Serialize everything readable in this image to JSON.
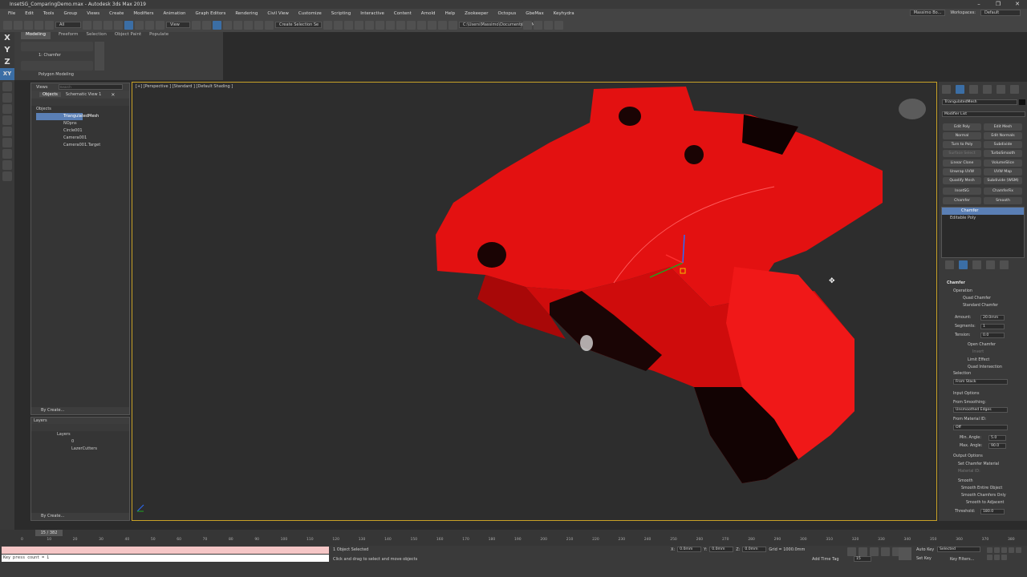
{
  "window": {
    "title": "InsetSG_ComparingDemo.max - Autodesk 3ds Max 2019"
  },
  "menu": [
    "File",
    "Edit",
    "Tools",
    "Group",
    "Views",
    "Create",
    "Modifiers",
    "Animation",
    "Graph Editors",
    "Rendering",
    "Civil View",
    "Customize",
    "Scripting",
    "Interactive",
    "Content",
    "Arnold",
    "Help",
    "Zookeeper",
    "Octopus",
    "GbeMax",
    "Keyhydra"
  ],
  "menu_right": {
    "user": "Massimo Bo...",
    "workspaces_label": "Workspaces:",
    "workspace": "Default"
  },
  "toolbar": {
    "selection_filter": "All",
    "view_dd": "View",
    "named_sel": "Create Selection Se",
    "path": "C:\\Users\\Massimo\\Documents\\3dsMax"
  },
  "ribbon": {
    "tabs": [
      "Modeling",
      "Freeform",
      "Selection",
      "Object Paint",
      "Populate"
    ],
    "level": "1: Chamfer",
    "panel": "Polygon Modeling"
  },
  "axes": [
    "X",
    "Y",
    "Z",
    "XY"
  ],
  "scene_explorer": {
    "header_views": "Views",
    "search_placeholder": "Search",
    "tab_objects": "Objects",
    "tab_schematic": "Schematic View 1",
    "root": "Objects",
    "items": [
      "TriangulatedMesh",
      "NOpns",
      "Circle001",
      "Camera001",
      "Camera001.Target"
    ],
    "footer": "By Create..."
  },
  "layers": {
    "title": "Layers",
    "root": "Layers",
    "items": [
      "0",
      "LazerCutters"
    ],
    "footer": "By Create..."
  },
  "viewport": {
    "label": "[+] [Perspective ] [Standard ] [Default Shading ]",
    "model_color": "#e31111"
  },
  "command_panel": {
    "object_name": "TriangulatedMesh",
    "modifier_list": "Modifier List",
    "modifier_buttons": [
      [
        "Edit Poly",
        "Edit Mesh"
      ],
      [
        "Normal",
        "Edit Normals"
      ],
      [
        "Turn to Poly",
        "Subdivide"
      ],
      [
        "Surface Select",
        "TurboSmooth"
      ],
      [
        "Linear Clone",
        "VolumeSlice"
      ],
      [
        "Unwrap UVW",
        "UVW Map"
      ],
      [
        "Quadify Mesh",
        "Subdivide (WSM)"
      ],
      [
        "InsetSG",
        "ChamferFix"
      ],
      [
        "Chamfer",
        "Smooth"
      ]
    ],
    "stack": [
      "Chamfer",
      "Editable Poly"
    ],
    "rollout_title": "Chamfer",
    "operation_label": "Operation",
    "op_quad": "Quad Chamfer",
    "op_standard": "Standard Chamfer",
    "amount_label": "Amount:",
    "amount": "20.0mm",
    "segments_label": "Segments:",
    "segments": "1",
    "tension_label": "Tension:",
    "tension": "0.0",
    "open_chamfer": "Open Chamfer",
    "invert": "Invert",
    "limit_effect": "Limit Effect",
    "quad_intersection": "Quad Intersection",
    "selection_label": "Selection",
    "selection_value": "From Stack",
    "input_options": "Input Options",
    "from_smoothing_label": "From Smoothing:",
    "from_smoothing": "Unsmoothed Edges",
    "from_material_label": "From Material ID:",
    "from_material": "Off",
    "min_angle_label": "Min. Angle:",
    "min_angle": "5.0",
    "max_angle_label": "Max. Angle:",
    "max_angle": "90.0",
    "output_options": "Output Options",
    "set_chamfer_material": "Set Chamfer Material",
    "material_id_label": "Material ID:",
    "smooth": "Smooth",
    "smooth_entire": "Smooth Entire Object",
    "smooth_chamfers": "Smooth Chamfers Only",
    "smooth_adjacent": "Smooth to Adjacent",
    "threshold_label": "Threshold:",
    "threshold": "180.0"
  },
  "timeline": {
    "frame": "15 / 382",
    "ticks": [
      "0",
      "10",
      "20",
      "30",
      "40",
      "50",
      "60",
      "70",
      "80",
      "90",
      "100",
      "110",
      "120",
      "130",
      "140",
      "150",
      "160",
      "170",
      "180",
      "190",
      "200",
      "210",
      "220",
      "230",
      "240",
      "250",
      "260",
      "270",
      "280",
      "290",
      "300",
      "310",
      "320",
      "330",
      "340",
      "350",
      "360",
      "370",
      "380"
    ]
  },
  "status": {
    "maxscript": "",
    "maxscript_out": "Key press count = 1",
    "selected": "1 Object Selected",
    "prompt": "Click and drag to select and move objects",
    "x_label": "X:",
    "x": "0.0mm",
    "y_label": "Y:",
    "y": "0.0mm",
    "z_label": "Z:",
    "z": "0.0mm",
    "grid": "Grid = 1000.0mm",
    "add_time_tag": "Add Time Tag",
    "auto_key": "Auto Key",
    "set_key": "Set Key",
    "selected_dd": "Selected",
    "key_filters": "Key Filters...",
    "frame_field": "15"
  }
}
